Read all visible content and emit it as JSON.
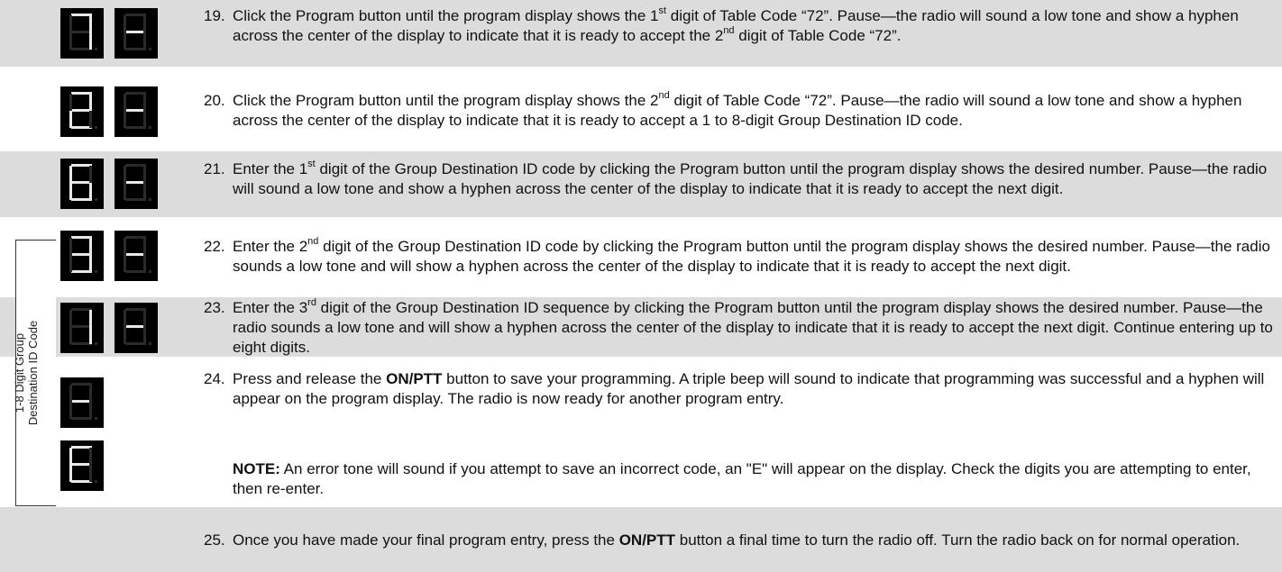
{
  "steps": [
    {
      "num": "19.",
      "parts": [
        "Click the Program button until the program display shows the 1",
        "st",
        " digit of Table Code “72”.  Pause—the radio will sound a low tone and show a hyphen across the center of the display to indicate that it is ready to accept the 2",
        "nd",
        " digit of Table Code “72”."
      ]
    },
    {
      "num": "20.",
      "parts": [
        "Click the Program button until the program display shows the 2",
        "nd",
        " digit of Table Code “72”.  Pause—the radio will sound a low tone and show a hyphen across the center of the display to indicate that it is ready to accept a 1 to 8-digit Group Destination ID code."
      ]
    },
    {
      "num": "21.",
      "parts": [
        "Enter the 1",
        "st",
        " digit of the Group Destination ID code by clicking the Program button until the program display shows the desired number. Pause—the radio will sound a low tone and show a hyphen across the center of the display to indicate that it is ready to accept the next digit."
      ]
    },
    {
      "num": "22.",
      "parts": [
        "Enter the 2",
        "nd",
        " digit of the Group Destination ID code by clicking the Program button until the program display shows the desired number.  Pause—the radio sounds a low tone and will show a hyphen across the center of the display to indicate that it is ready to accept the next digit."
      ]
    },
    {
      "num": "23.",
      "parts": [
        "Enter the 3",
        "rd",
        " digit of the Group Destination ID sequence by clicking the Program button until the program display shows the desired number. Pause—the radio sounds a low tone and will show a hyphen across the center of the display to indicate that it is ready to accept the next digit.  Continue entering up to eight digits."
      ]
    },
    {
      "num": "24.",
      "bold": "ON/PTT",
      "pre": "Press and release the ",
      "post": " button to save your programming. A triple beep will sound to indicate that programming was successful and a hyphen will appear on the program display.  The radio is now ready for another program entry.",
      "note_label": "NOTE:",
      "note": "  An error tone will sound if you attempt to save an incorrect code, an \"E\" will appear on the display.  Check the digits you are attempting to enter, then re-enter."
    },
    {
      "num": "25.",
      "bold": "ON/PTT",
      "pre": "Once you have made your final program entry, press the ",
      "post": " button a final time to turn the radio off.  Turn the radio back on for normal operation."
    }
  ],
  "displays": [
    {
      "row": 19,
      "chars": [
        "7",
        "-"
      ]
    },
    {
      "row": 20,
      "chars": [
        "2",
        "-"
      ]
    },
    {
      "row": 21,
      "chars": [
        "6",
        "-"
      ]
    },
    {
      "row": 22,
      "chars": [
        "3",
        "-"
      ]
    },
    {
      "row": 23,
      "chars": [
        "1",
        "-"
      ]
    },
    {
      "row": 24,
      "chars": [
        "-"
      ]
    },
    {
      "row": 24,
      "chars": [
        "E"
      ]
    }
  ],
  "bracket_label": [
    "1-8 Digit Group",
    "Destination ID Code"
  ],
  "colors": {
    "shade": "#dcdcdc",
    "segment_on": "#e8e8e8",
    "segment_off": "#2a2a2a",
    "display_bg": "#000000"
  }
}
